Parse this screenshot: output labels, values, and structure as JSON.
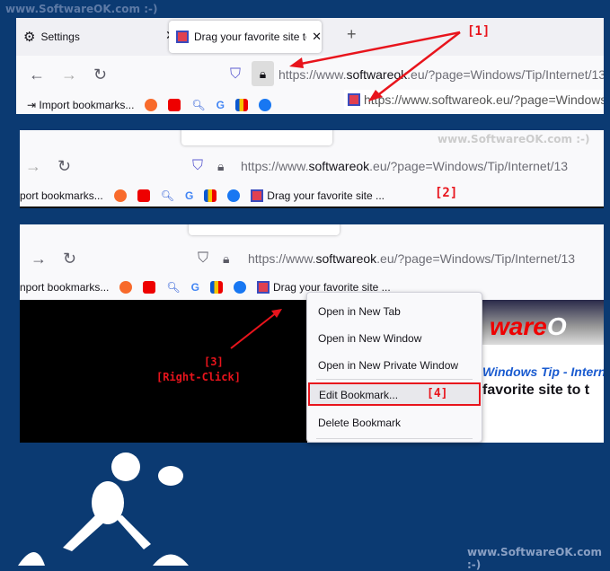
{
  "watermark_top": "www.SoftwareOK.com :-)",
  "watermark_mid": "www.SoftwareOK.com :-)",
  "watermark_bottom": "www.SoftwareOK.com :-)",
  "tabs": [
    {
      "label": "Settings",
      "icon": "gear-icon"
    },
    {
      "label": "Drag your favorite site to the bo",
      "icon": "site-favicon"
    }
  ],
  "url_prefix": "https://www.",
  "url_domain": "softwareok",
  "url_suffix": ".eu/?page=Windows/Tip/Internet/13",
  "drag_url": "https://www.softwareok.eu/?page=Windows",
  "bookmarks": {
    "import": "Import bookmarks...",
    "import_cut": "port bookmarks...",
    "import_cut2": "nport bookmarks...",
    "new_bookmark": "Drag your favorite site ..."
  },
  "labels": {
    "step1": "[1]",
    "step2": "[2]",
    "step3": "[3]",
    "step3b": "[Right-Click]",
    "step4": "[4]"
  },
  "context_menu": [
    "Open in New Tab",
    "Open in New Window",
    "Open in New Private Window",
    "Edit Bookmark...",
    "Delete Bookmark"
  ],
  "site": {
    "logo": "ware",
    "logo_o": "O",
    "tip": "Windows Tip - Intern",
    "heading": "favorite site to t"
  },
  "colors": {
    "background": "#0b3a72",
    "annotation": "#e8141c"
  }
}
